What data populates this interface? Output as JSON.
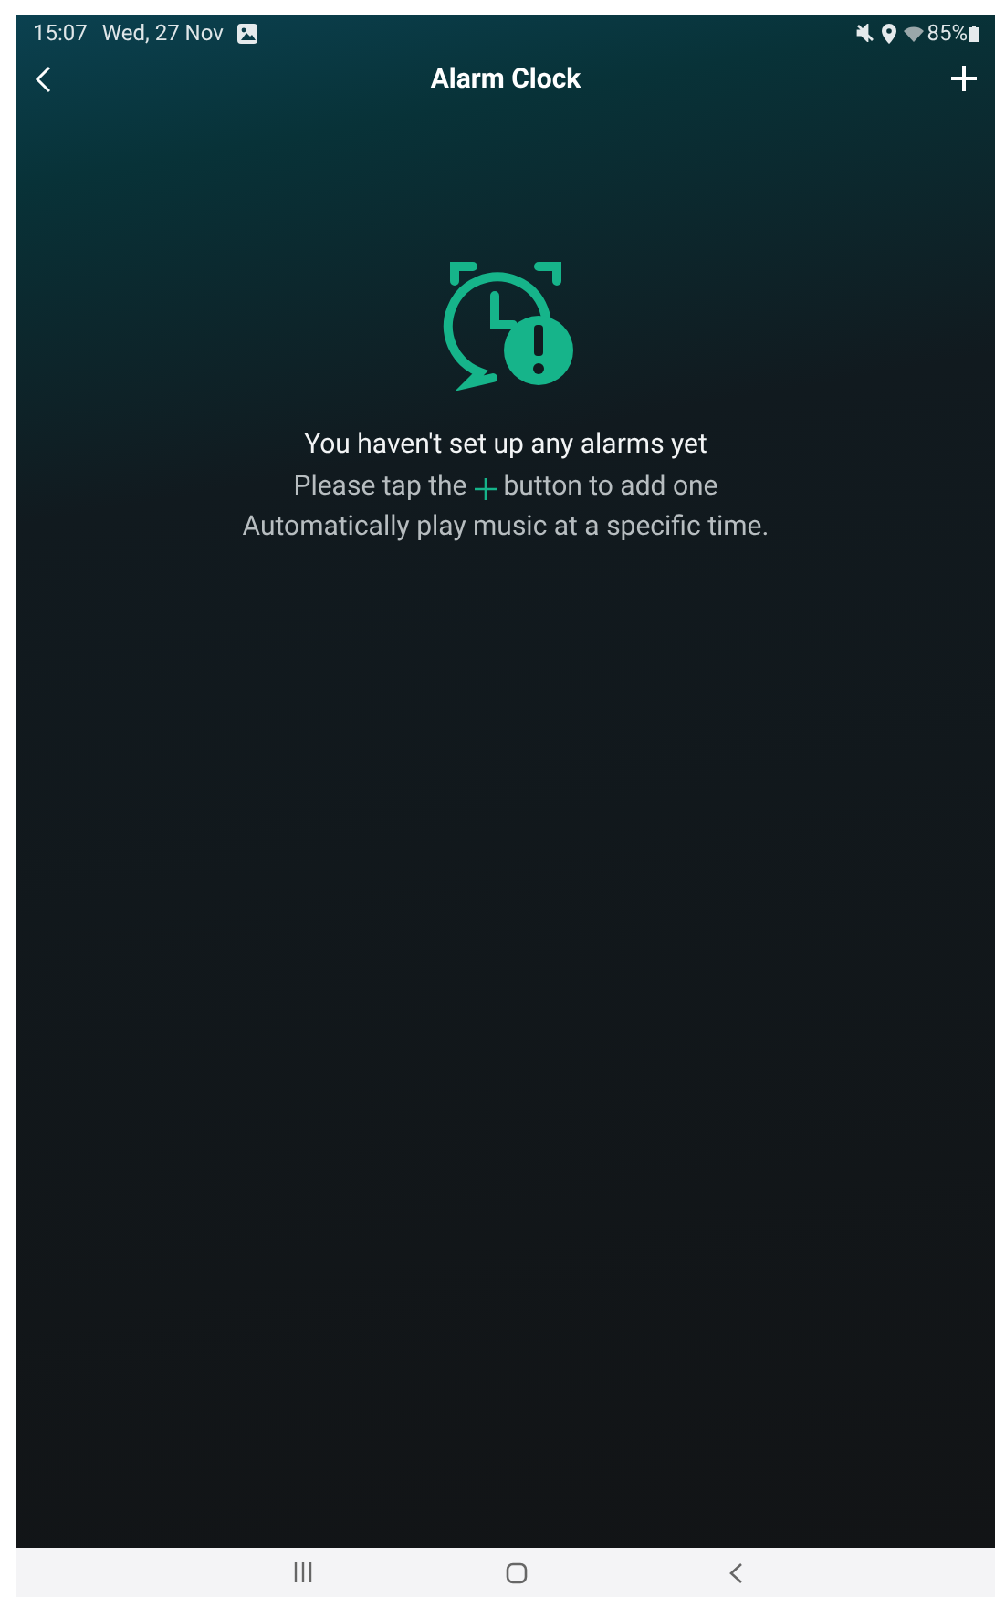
{
  "status_bar": {
    "time": "15:07",
    "date": "Wed, 27 Nov",
    "battery": "85%"
  },
  "header": {
    "title": "Alarm Clock"
  },
  "empty_state": {
    "title": "You haven't set up any alarms yet",
    "hint_before": "Please tap the",
    "hint_after": "button to add one",
    "description": "Automatically play music at a specific time."
  }
}
